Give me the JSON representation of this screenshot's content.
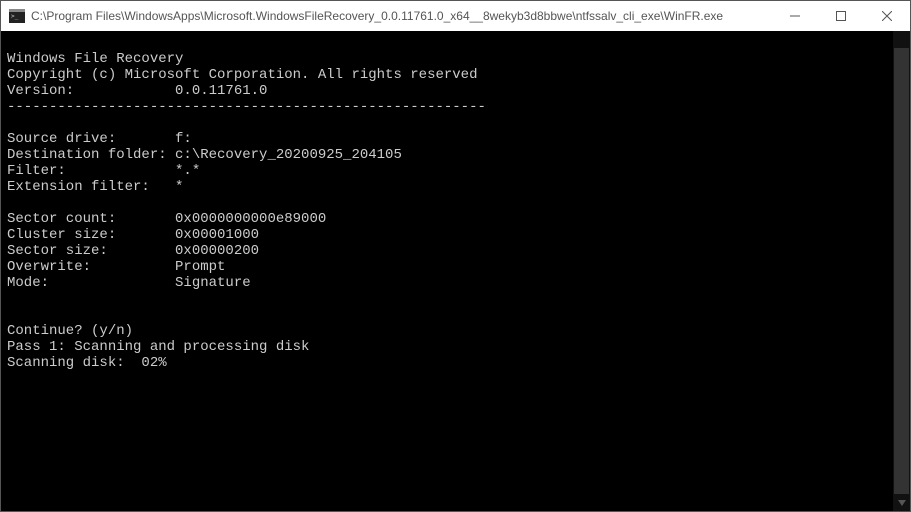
{
  "window": {
    "title": "C:\\Program Files\\WindowsApps\\Microsoft.WindowsFileRecovery_0.0.11761.0_x64__8wekyb3d8bbwe\\ntfssalv_cli_exe\\WinFR.exe"
  },
  "terminal": {
    "lines": [
      "",
      "Windows File Recovery",
      "Copyright (c) Microsoft Corporation. All rights reserved",
      "Version:            0.0.11761.0",
      "---------------------------------------------------------",
      "",
      "Source drive:       f:",
      "Destination folder: c:\\Recovery_20200925_204105",
      "Filter:             *.*",
      "Extension filter:   *",
      "",
      "Sector count:       0x0000000000e89000",
      "Cluster size:       0x00001000",
      "Sector size:        0x00000200",
      "Overwrite:          Prompt",
      "Mode:               Signature",
      "",
      "",
      "Continue? (y/n)",
      "Pass 1: Scanning and processing disk",
      "Scanning disk:  02%"
    ]
  }
}
